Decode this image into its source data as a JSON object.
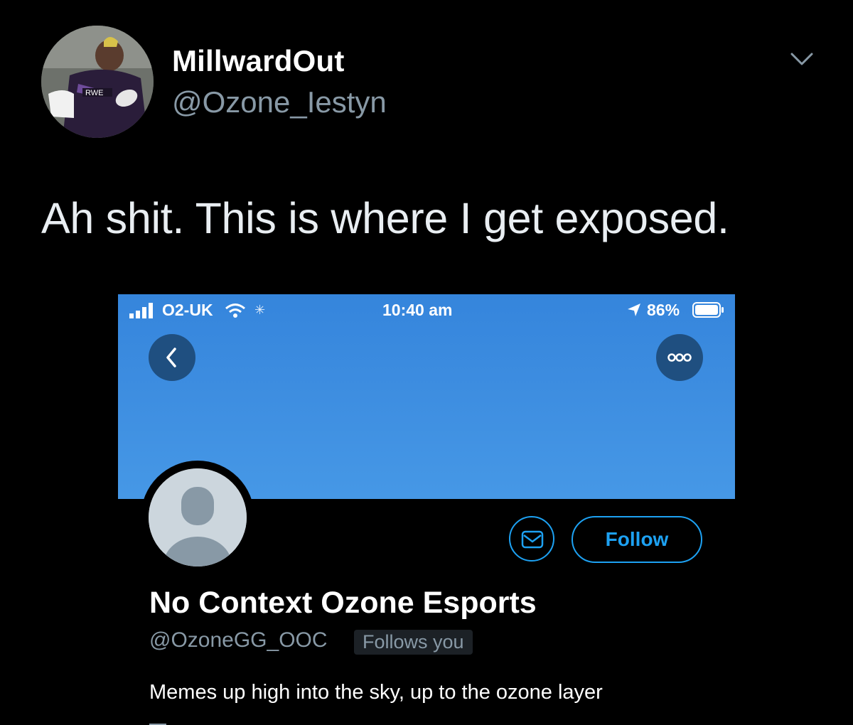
{
  "tweet": {
    "display_name": "MillwardOut",
    "handle": "@Ozone_Iestyn",
    "text": "Ah shit. This is where I get exposed.",
    "avatar_label": "RWE",
    "menu_icon": "chevron-down-icon"
  },
  "embedded_screenshot": {
    "status_bar": {
      "carrier": "O2-UK",
      "time": "10:40 am",
      "battery": "86%",
      "battery_level": 0.86
    },
    "profile": {
      "name": "No Context Ozone Esports",
      "handle": "@OzoneGG_OOC",
      "follows_you_label": "Follows you",
      "bio": "Memes up high into the sky, up to the ozone layer",
      "follow_label": "Follow"
    },
    "colors": {
      "banner": "#3d8de0",
      "accent": "#1da1f2",
      "dark_button": "#1f4f80"
    }
  }
}
